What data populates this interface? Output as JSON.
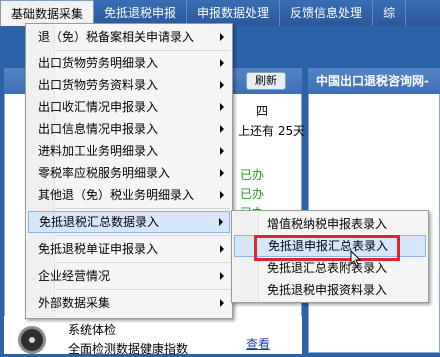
{
  "menubar": {
    "items": [
      {
        "label": "基础数据采集",
        "active": true
      },
      {
        "label": "免抵退税申报",
        "active": false
      },
      {
        "label": "申报数据处理",
        "active": false
      },
      {
        "label": "反馈信息处理",
        "active": false
      },
      {
        "label": "综",
        "active": false
      }
    ]
  },
  "background": {
    "refresh_label": "刷新",
    "right_panel_title": "中国出口退税咨询网-",
    "day_fragment": "四",
    "deadline_text": "上还有 25天",
    "status_items": [
      "已办",
      "已办",
      "已办",
      "已办"
    ],
    "system_check_title": "系统体检",
    "system_check_desc": "全面检测数据健康指数",
    "view_link": "查看"
  },
  "dropdown": {
    "items": [
      {
        "label": "退（免）税备案相关申请录入",
        "has_submenu": true
      },
      {
        "label": "出口货物劳务明细录入",
        "has_submenu": true
      },
      {
        "label": "出口货物劳务资料录入",
        "has_submenu": true
      },
      {
        "label": "出口收汇情况申报录入",
        "has_submenu": true
      },
      {
        "label": "出口信息情况申报录入",
        "has_submenu": true
      },
      {
        "label": "进料加工业务明细录入",
        "has_submenu": true
      },
      {
        "label": "零税率应税服务明细录入",
        "has_submenu": true
      },
      {
        "label": "其他退（免）税业务明细录入",
        "has_submenu": true
      },
      {
        "label": "免抵退税汇总数据录入",
        "has_submenu": true,
        "highlighted": true
      },
      {
        "label": "免抵退税单证申报录入",
        "has_submenu": true
      },
      {
        "label": "企业经营情况",
        "has_submenu": true
      },
      {
        "label": "外部数据采集",
        "has_submenu": true
      }
    ]
  },
  "submenu": {
    "items": [
      {
        "label": "增值税纳税申报表录入"
      },
      {
        "label": "免抵退申报汇总表录入",
        "highlighted": true
      },
      {
        "label": "免抵退汇总表附表录入"
      },
      {
        "label": "免抵退税申报资料录入"
      }
    ]
  },
  "colors": {
    "menubar": "#2a5899",
    "highlight_bg": "#d6e6fb",
    "highlight_border": "#8ab4e7",
    "annotation_red": "#d9282f",
    "status_green": "#1a9a1a"
  }
}
